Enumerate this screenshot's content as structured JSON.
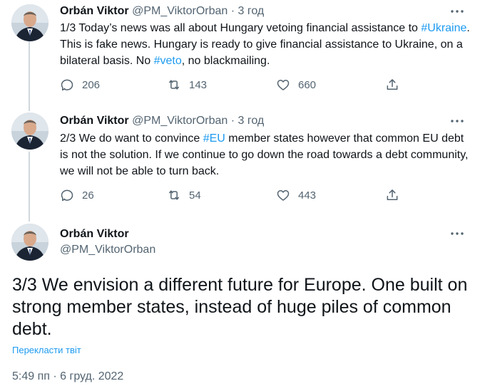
{
  "tweets": [
    {
      "name": "Orbán Viktor",
      "handle": "@PM_ViktorOrban",
      "separator": "·",
      "time": "3 год",
      "text": [
        {
          "t": "1/3 Today’s news was all about Hungary vetoing financial assistance to "
        },
        {
          "t": "#Ukraine",
          "link": true
        },
        {
          "t": ". This is fake news. Hungary is ready to give financial assistance to Ukraine, on a bilateral basis. No "
        },
        {
          "t": "#veto",
          "link": true
        },
        {
          "t": ", no blackmailing."
        }
      ],
      "replies": "206",
      "retweets": "143",
      "likes": "660"
    },
    {
      "name": "Orbán Viktor",
      "handle": "@PM_ViktorOrban",
      "separator": "·",
      "time": "3 год",
      "text": [
        {
          "t": "2/3 We do want to convince "
        },
        {
          "t": "#EU",
          "link": true
        },
        {
          "t": " member states however that common EU debt is not the solution. If we continue to go down the road towards a debt community, we will not be able to turn back."
        }
      ],
      "replies": "26",
      "retweets": "54",
      "likes": "443"
    }
  ],
  "main": {
    "name": "Orbán Viktor",
    "handle": "@PM_ViktorOrban",
    "text": "3/3 We envision a different future for Europe. One built on strong member states, instead of huge piles of common debt.",
    "translate_label": "Перекласти твіт",
    "timestamp": "5:49 пп · 6 груд. 2022"
  },
  "icons": {
    "reply": "reply-icon",
    "retweet": "retweet-icon",
    "like": "heart-icon",
    "share": "share-icon",
    "more": "more-icon"
  },
  "colors": {
    "link": "#1d9bf0",
    "secondary_text": "#536471",
    "primary_text": "#0f1419",
    "thread_line": "#cfd9de"
  }
}
